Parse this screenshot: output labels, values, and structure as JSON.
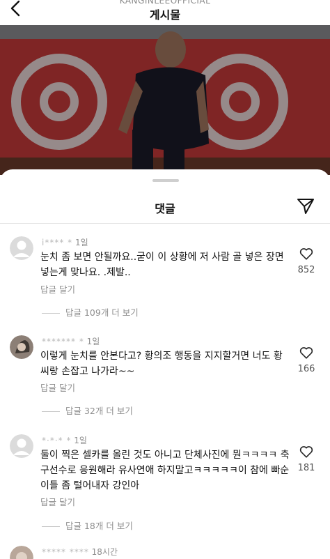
{
  "header": {
    "account_name": "KANGINLEEOFFICIAL",
    "title": "게시물",
    "back_icon": "chevron-left-icon"
  },
  "sheet": {
    "title": "댓글",
    "share_icon": "paper-plane-icon"
  },
  "comments": [
    {
      "username": "i**** *",
      "time": "1일",
      "text": "눈치 좀 보면 안될까요..굳이 이 상황에 저 사람 골 넣은 장면 넣는게 맞나요. .제발..",
      "reply_label": "답글 달기",
      "more_replies": "답글 109개 더 보기",
      "likes": "852",
      "avatar": "default-avatar"
    },
    {
      "username": "******* *",
      "time": "1일",
      "text": "이렇게 눈치를 안본다고? 황의조 행동을 지지할거면 너도 황씨랑 손잡고 나가라~~",
      "reply_label": "답글 달기",
      "more_replies": "답글 32개 더 보기",
      "likes": "166",
      "avatar": "photo-avatar"
    },
    {
      "username": "*·*·* *",
      "time": "1일",
      "text": "둘이 찍은 셀카를 올린 것도 아니고 단체사진에 뭔ㅋㅋㅋㅋ 축구선수로 응원해라 유사연애 하지말고ㅋㅋㅋㅋㅋ이 참에 빠순이들 좀 털어내자 강인아",
      "reply_label": "답글 달기",
      "more_replies": "답글 18개 더 보기",
      "likes": "181",
      "avatar": "default-avatar"
    },
    {
      "username": "***** ****",
      "time": "18시간",
      "avatar": "photo-avatar"
    }
  ]
}
